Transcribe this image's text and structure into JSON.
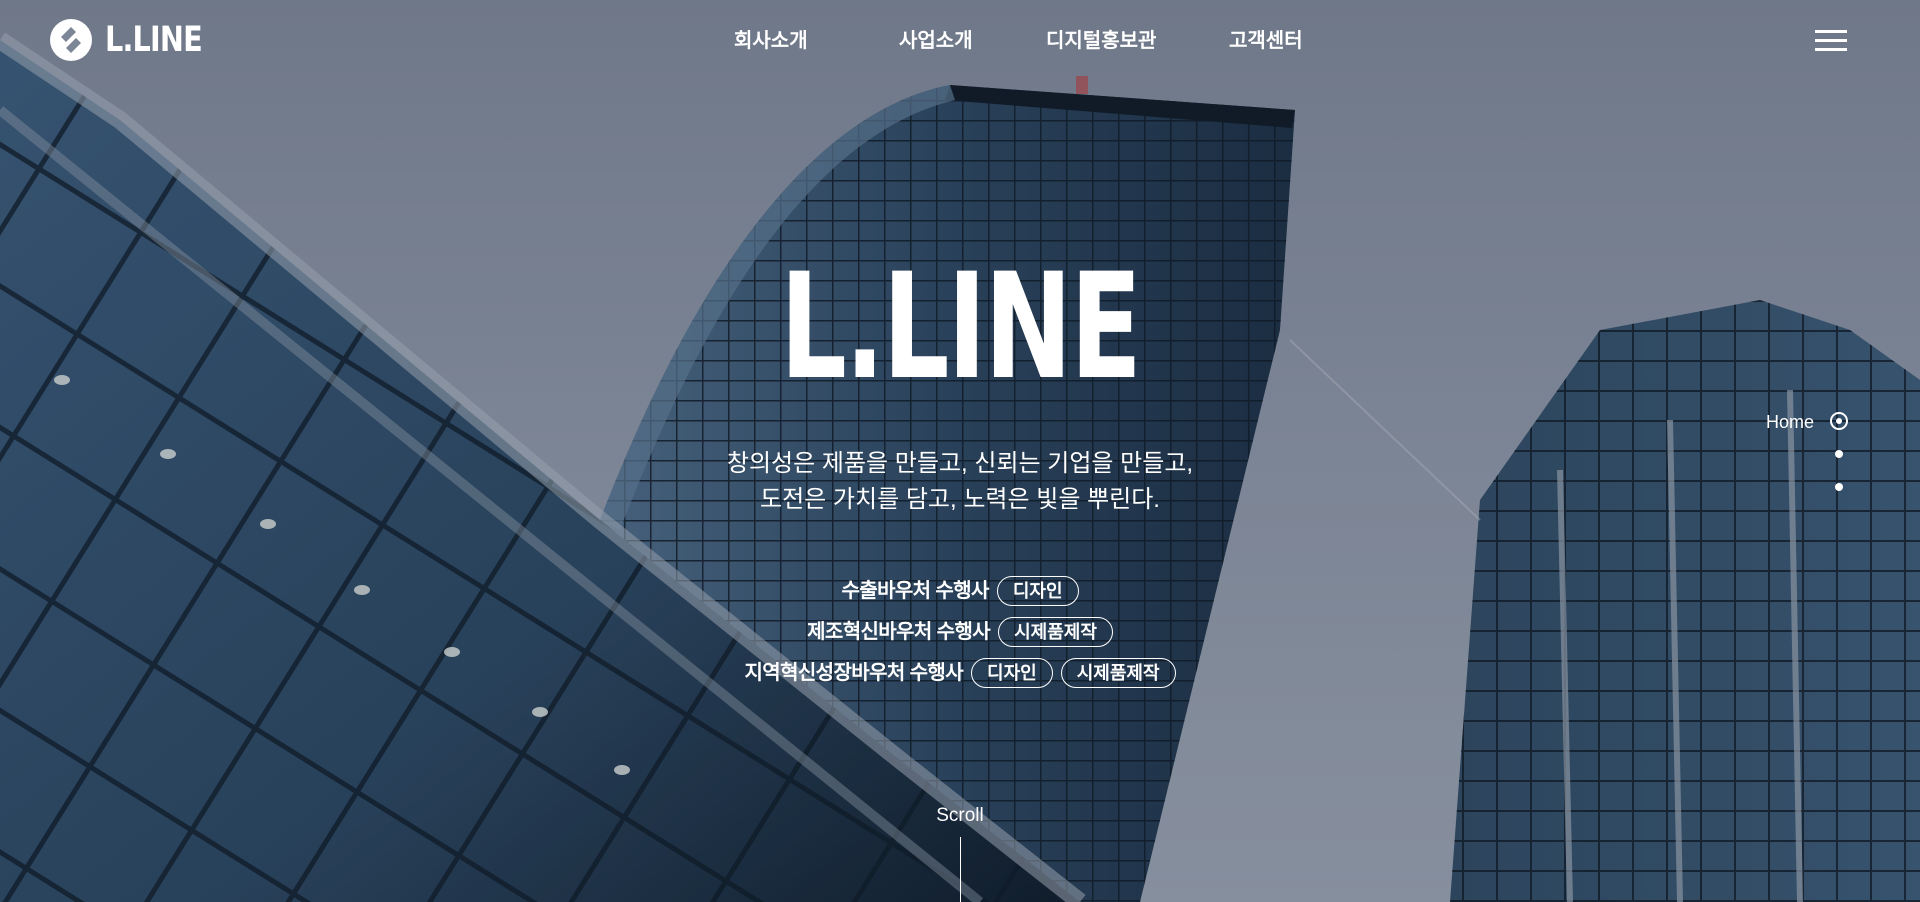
{
  "header": {
    "logo_text": "L.LINE",
    "nav": [
      {
        "label": "회사소개"
      },
      {
        "label": "사업소개"
      },
      {
        "label": "디지털홍보관"
      },
      {
        "label": "고객센터"
      }
    ],
    "menu_icon": "hamburger-menu-icon"
  },
  "hero": {
    "title": "L.LINE",
    "tagline_line1": "창의성은 제품을 만들고, 신뢰는 기업을 만들고,",
    "tagline_line2": "도전은 가치를 담고, 노력은 빛을 뿌린다.",
    "vouchers": [
      {
        "name": "수출바우처 수행사",
        "tags": [
          "디자인"
        ]
      },
      {
        "name": "제조혁신바우처 수행사",
        "tags": [
          "시제품제작"
        ]
      },
      {
        "name": "지역혁신성장바우처 수행사",
        "tags": [
          "디자인",
          "시제품제작"
        ]
      }
    ]
  },
  "side_nav": {
    "active_label": "Home",
    "dot_count": 3,
    "active_index": 0
  },
  "scroll": {
    "label": "Scroll"
  },
  "colors": {
    "text": "#ffffff",
    "sky": "#8a93a3",
    "glass": "#2f4a66"
  }
}
